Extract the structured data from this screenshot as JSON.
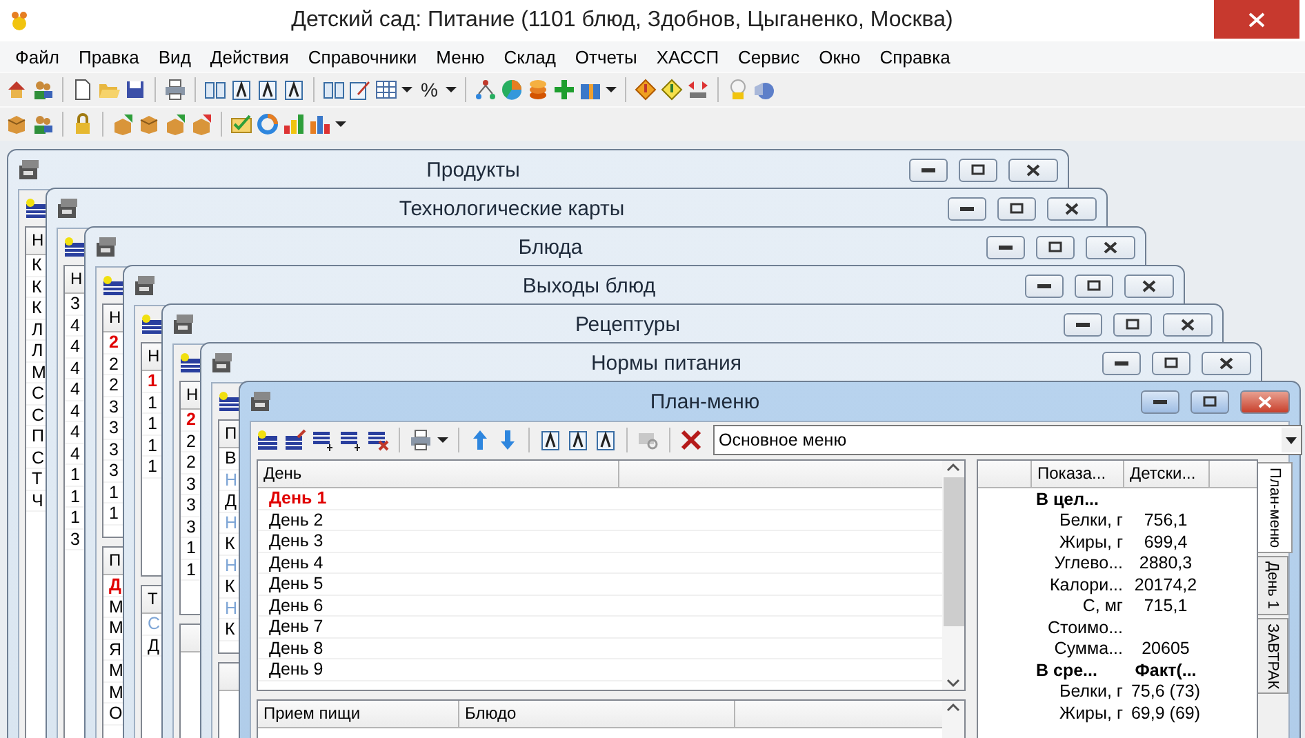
{
  "app": {
    "title": "Детский сад: Питание (1101 блюд, Здобнов, Цыганенко, Москва)"
  },
  "menu": [
    "Файл",
    "Правка",
    "Вид",
    "Действия",
    "Справочники",
    "Меню",
    "Склад",
    "Отчеты",
    "ХАССП",
    "Сервис",
    "Окно",
    "Справка"
  ],
  "toolbar": {
    "percent": "%"
  },
  "windows": [
    {
      "title": "Продукты",
      "active": false,
      "grids": [
        {
          "header": "Н",
          "rows": [
            {
              "text": "К",
              "kind": "normal"
            },
            {
              "text": "К",
              "kind": "normal"
            },
            {
              "text": "К",
              "kind": "normal"
            },
            {
              "text": "Л",
              "kind": "normal"
            },
            {
              "text": "Л",
              "kind": "normal"
            },
            {
              "text": "М",
              "kind": "normal"
            },
            {
              "text": "С",
              "kind": "normal"
            },
            {
              "text": "С",
              "kind": "normal"
            },
            {
              "text": "П",
              "kind": "normal"
            },
            {
              "text": "С",
              "kind": "normal"
            },
            {
              "text": "Т",
              "kind": "normal"
            },
            {
              "text": "Ч",
              "kind": "normal"
            }
          ]
        }
      ]
    },
    {
      "title": "Технологические карты",
      "active": false,
      "grids": [
        {
          "header": "Н",
          "rows": [
            {
              "text": "3",
              "kind": "normal"
            },
            {
              "text": "4",
              "kind": "normal"
            },
            {
              "text": "4",
              "kind": "normal"
            },
            {
              "text": "4",
              "kind": "normal"
            },
            {
              "text": "4",
              "kind": "normal"
            },
            {
              "text": "4",
              "kind": "normal"
            },
            {
              "text": "4",
              "kind": "normal"
            },
            {
              "text": "4",
              "kind": "normal"
            },
            {
              "text": "1",
              "kind": "normal"
            },
            {
              "text": "1",
              "kind": "normal"
            },
            {
              "text": "1",
              "kind": "normal"
            },
            {
              "text": "3",
              "kind": "normal"
            }
          ]
        }
      ]
    },
    {
      "title": "Блюда",
      "active": false,
      "grids": [
        {
          "header": "Н",
          "rows": [
            {
              "text": "2",
              "kind": "current"
            },
            {
              "text": "2",
              "kind": "normal"
            },
            {
              "text": "2",
              "kind": "normal"
            },
            {
              "text": "3",
              "kind": "normal"
            },
            {
              "text": "3",
              "kind": "normal"
            },
            {
              "text": "3",
              "kind": "normal"
            },
            {
              "text": "3",
              "kind": "normal"
            },
            {
              "text": "1",
              "kind": "normal"
            },
            {
              "text": "1",
              "kind": "normal"
            }
          ]
        },
        {
          "header": "П",
          "rows": [
            {
              "text": "Д",
              "kind": "current"
            },
            {
              "text": "М",
              "kind": "normal"
            },
            {
              "text": "М",
              "kind": "normal"
            },
            {
              "text": "Я",
              "kind": "normal"
            },
            {
              "text": "М",
              "kind": "normal"
            },
            {
              "text": "М",
              "kind": "normal"
            },
            {
              "text": "О",
              "kind": "normal"
            }
          ]
        }
      ]
    },
    {
      "title": "Выходы блюд",
      "active": false,
      "grids": [
        {
          "header": "Н",
          "rows": [
            {
              "text": "1",
              "kind": "current"
            },
            {
              "text": "1",
              "kind": "normal"
            },
            {
              "text": "1",
              "kind": "normal"
            },
            {
              "text": "1",
              "kind": "normal"
            },
            {
              "text": "1",
              "kind": "normal"
            }
          ]
        },
        {
          "header": "Т",
          "rows": [
            {
              "text": "С",
              "kind": "group"
            },
            {
              "text": "Д",
              "kind": "normal"
            }
          ]
        }
      ]
    },
    {
      "title": "Рецептуры",
      "active": false,
      "lower_panel": true,
      "grids": [
        {
          "header": "Н",
          "rows": [
            {
              "text": "2",
              "kind": "current"
            },
            {
              "text": "2",
              "kind": "normal"
            },
            {
              "text": "2",
              "kind": "normal"
            },
            {
              "text": "3",
              "kind": "normal"
            },
            {
              "text": "3",
              "kind": "normal"
            },
            {
              "text": "3",
              "kind": "normal"
            },
            {
              "text": "1",
              "kind": "normal"
            },
            {
              "text": "1",
              "kind": "normal"
            }
          ]
        }
      ]
    },
    {
      "title": "Нормы питания",
      "active": false,
      "lower_panel": true,
      "grids": [
        {
          "header": "П",
          "rows": [
            {
              "text": "В",
              "kind": "normal"
            },
            {
              "text": "Н",
              "kind": "group"
            },
            {
              "text": "Д",
              "kind": "normal"
            },
            {
              "text": "Н",
              "kind": "group"
            },
            {
              "text": "К",
              "kind": "normal"
            },
            {
              "text": "Н",
              "kind": "group"
            },
            {
              "text": "К",
              "kind": "normal"
            },
            {
              "text": "Н",
              "kind": "group"
            },
            {
              "text": "К",
              "kind": "normal"
            }
          ]
        }
      ]
    }
  ],
  "plan_menu": {
    "title": "План-меню",
    "active": true,
    "menu_select": {
      "value": "Основное меню"
    },
    "days": {
      "columns": [
        "День"
      ],
      "rows": [
        {
          "text": "День 1",
          "selected": true
        },
        {
          "text": "День 2",
          "selected": false
        },
        {
          "text": "День 3",
          "selected": false
        },
        {
          "text": "День 4",
          "selected": false
        },
        {
          "text": "День 5",
          "selected": false
        },
        {
          "text": "День 6",
          "selected": false
        },
        {
          "text": "День 7",
          "selected": false
        },
        {
          "text": "День 8",
          "selected": false
        },
        {
          "text": "День 9",
          "selected": false
        }
      ]
    },
    "meals": {
      "columns": [
        "Прием пищи",
        "Блюдо"
      ]
    },
    "nutrients": {
      "columns": [
        "Показа...",
        "Детски..."
      ],
      "rows": [
        {
          "label": "В цел...",
          "kind": "group"
        },
        {
          "label": "Белки, г",
          "value": "756,1",
          "kind": "item"
        },
        {
          "label": "Жиры, г",
          "value": "699,4",
          "kind": "item"
        },
        {
          "label": "Углево...",
          "value": "2880,3",
          "kind": "item"
        },
        {
          "label": "Калори...",
          "value": "20174,2",
          "kind": "item"
        },
        {
          "label": "С, мг",
          "value": "715,1",
          "kind": "item"
        },
        {
          "label": "Стоимо...",
          "kind": "item"
        },
        {
          "label": "Сумма...",
          "value": "20605",
          "kind": "item"
        },
        {
          "label": "В сре...",
          "value": "Факт(...",
          "kind": "group"
        },
        {
          "label": "Белки, г",
          "value": "75,6 (73)",
          "kind": "item"
        },
        {
          "label": "Жиры, г",
          "value": "69,9 (69)",
          "kind": "item"
        }
      ]
    },
    "side_tabs": [
      {
        "label": "План-меню",
        "selected": true
      },
      {
        "label": "День 1",
        "selected": false
      },
      {
        "label": "ЗАВТРАК",
        "selected": false
      }
    ]
  }
}
